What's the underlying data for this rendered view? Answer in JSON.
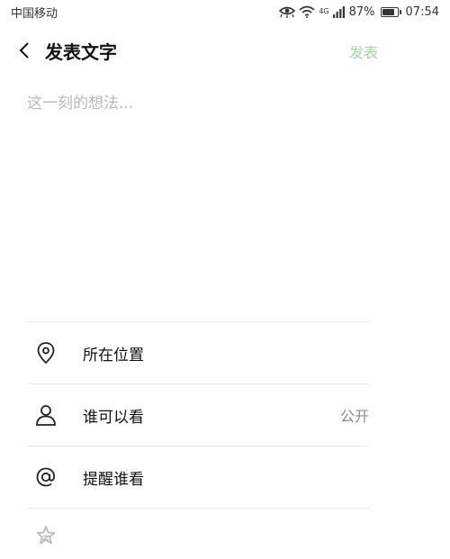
{
  "status_bar": {
    "carrier": "中国移动",
    "network": "4G",
    "battery_percent": "87%",
    "battery_level": 0.87,
    "time": "07:54",
    "icons": [
      "eye-comfort-icon",
      "wifi-icon",
      "signal-icon",
      "battery-icon"
    ]
  },
  "header": {
    "back_icon": "chevron-left-icon",
    "title": "发表文字",
    "publish_label": "发表"
  },
  "compose": {
    "placeholder": "这一刻的想法...",
    "value": ""
  },
  "options": [
    {
      "icon": "location-pin-icon",
      "label": "所在位置",
      "value": ""
    },
    {
      "icon": "person-icon",
      "label": "谁可以看",
      "value": "公开"
    },
    {
      "icon": "at-sign-icon",
      "label": "提醒谁看",
      "value": ""
    },
    {
      "icon": "star-icon",
      "label": "",
      "value": ""
    }
  ],
  "colors": {
    "publish_disabled": "#9fd6a4",
    "placeholder": "#b8b8b8",
    "divider": "#e8e8e8",
    "secondary_text": "#888888"
  }
}
